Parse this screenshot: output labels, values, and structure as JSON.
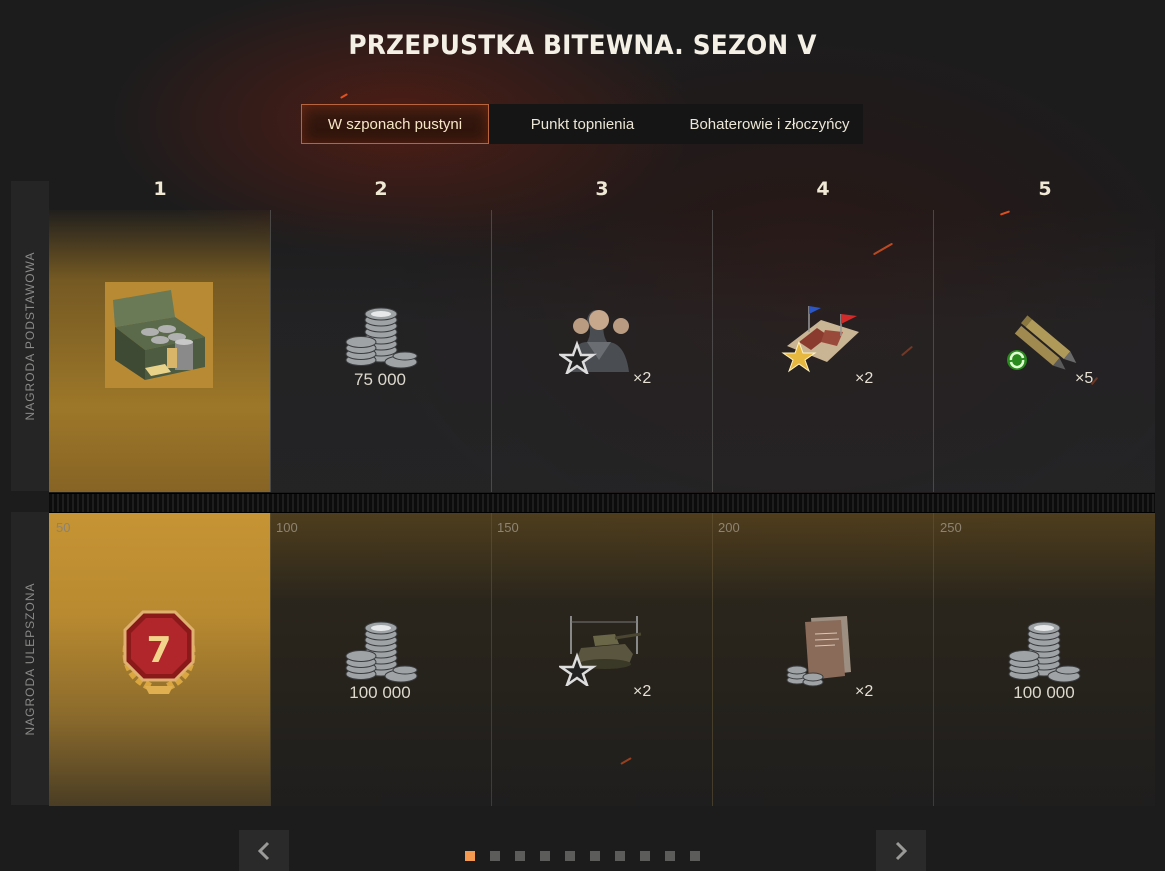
{
  "title": "PRZEPUSTKA BITEWNA. SEZON V",
  "tabs": [
    {
      "label": "W szponach pustyni",
      "active": true
    },
    {
      "label": "Punkt topnienia",
      "active": false
    },
    {
      "label": "Bohaterowie i złoczyńcy",
      "active": false
    }
  ],
  "rows": {
    "basic_label": "NAGRODA PODSTAWOWA",
    "upgraded_label": "NAGRODA ULEPSZONA"
  },
  "columns": [
    {
      "number": "1",
      "points": "50",
      "basic": {
        "icon": "supply-box-icon",
        "text": ""
      },
      "upgraded": {
        "icon": "tier-7-badge-icon",
        "text": ""
      }
    },
    {
      "number": "2",
      "points": "100",
      "basic": {
        "icon": "silver-coins-icon",
        "text": "75 000"
      },
      "upgraded": {
        "icon": "silver-coins-icon",
        "text": "100 000"
      }
    },
    {
      "number": "3",
      "points": "150",
      "basic": {
        "icon": "crew-icon",
        "text": "×2"
      },
      "upgraded": {
        "icon": "tank-style-icon",
        "text": "×2"
      }
    },
    {
      "number": "4",
      "points": "200",
      "basic": {
        "icon": "map-flags-icon",
        "text": "×2"
      },
      "upgraded": {
        "icon": "documents-credits-icon",
        "text": "×2"
      }
    },
    {
      "number": "5",
      "points": "250",
      "basic": {
        "icon": "shells-icon",
        "text": "×5"
      },
      "upgraded": {
        "icon": "silver-coins-icon",
        "text": "100 000"
      }
    }
  ],
  "pagination": {
    "pages": 10,
    "current": 1
  },
  "colors": {
    "accent": "#f39a50",
    "gold": "#c69434",
    "tab_border": "#b8643e"
  }
}
